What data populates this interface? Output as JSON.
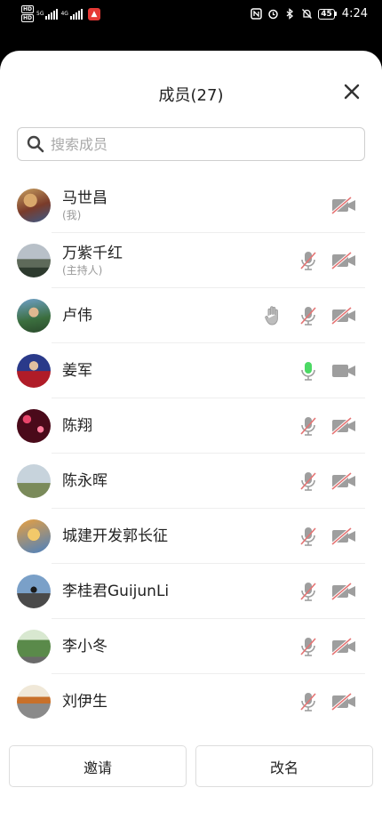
{
  "status_bar": {
    "time": "4:24",
    "battery": "45",
    "hd1": "HD",
    "hd2": "HD",
    "net1": "5G",
    "net2": "4G"
  },
  "header": {
    "title": "成员(27)"
  },
  "search": {
    "placeholder": "搜索成员"
  },
  "members": [
    {
      "name": "马世昌",
      "role": "(我)",
      "hand": false,
      "mic": "none",
      "camera": "off"
    },
    {
      "name": "万紫千红",
      "role": "(主持人)",
      "hand": false,
      "mic": "off",
      "camera": "off"
    },
    {
      "name": "卢伟",
      "role": "",
      "hand": true,
      "mic": "off",
      "camera": "off"
    },
    {
      "name": "姜军",
      "role": "",
      "hand": false,
      "mic": "on",
      "camera": "on"
    },
    {
      "name": "陈翔",
      "role": "",
      "hand": false,
      "mic": "off",
      "camera": "off"
    },
    {
      "name": "陈永晖",
      "role": "",
      "hand": false,
      "mic": "off",
      "camera": "off"
    },
    {
      "name": "城建开发郭长征",
      "role": "",
      "hand": false,
      "mic": "off",
      "camera": "off"
    },
    {
      "name": "李桂君GuijunLi",
      "role": "",
      "hand": false,
      "mic": "off",
      "camera": "off"
    },
    {
      "name": "李小冬",
      "role": "",
      "hand": false,
      "mic": "off",
      "camera": "off"
    },
    {
      "name": "刘伊生",
      "role": "",
      "hand": false,
      "mic": "off",
      "camera": "off"
    }
  ],
  "footer": {
    "invite_label": "邀请",
    "rename_label": "改名"
  },
  "colors": {
    "icon_gray": "#9e9e9e",
    "muted_red": "#e57373",
    "mic_active": "#4cd964"
  }
}
